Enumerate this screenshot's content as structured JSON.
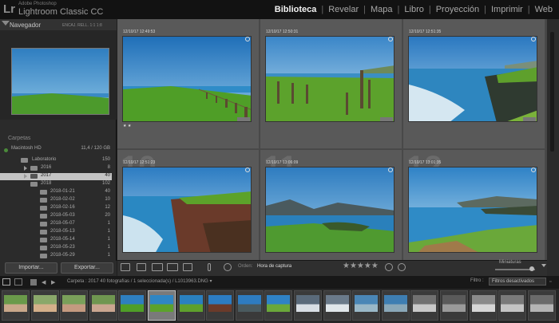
{
  "app": {
    "logo": "Lr",
    "brand_sub": "Adobe Photoshop",
    "brand_main": "Lightroom Classic CC"
  },
  "modules": [
    "Biblioteca",
    "Revelar",
    "Mapa",
    "Libro",
    "Proyección",
    "Imprimir",
    "Web"
  ],
  "active_module": "Biblioteca",
  "navigator": {
    "title": "Navegador",
    "zoom_options": "ENCAJ.  RELL.  1:1  1:8"
  },
  "folders": {
    "header": "Carpetas",
    "drive": {
      "name": "Macintosh HD",
      "info": "11,4 / 120 GB"
    },
    "rows": [
      {
        "label": "Laboratorio",
        "count": "150"
      },
      {
        "label": "2016",
        "count": "8"
      },
      {
        "label": "2017",
        "count": "40"
      },
      {
        "label": "2018",
        "count": "102"
      },
      {
        "label": "2018-01-21",
        "count": "40"
      },
      {
        "label": "2018-02-02",
        "count": "10"
      },
      {
        "label": "2018-02-16",
        "count": "12"
      },
      {
        "label": "2018-05-03",
        "count": "20"
      },
      {
        "label": "2018-05-07",
        "count": "1"
      },
      {
        "label": "2018-05-13",
        "count": "1"
      },
      {
        "label": "2018-05-14",
        "count": "1"
      },
      {
        "label": "2018-05-23",
        "count": "1"
      },
      {
        "label": "2018-05-29",
        "count": "1"
      }
    ]
  },
  "buttons": {
    "import": "Importar...",
    "export": "Exportar..."
  },
  "grid": [
    {
      "num": "",
      "timestamp": "12/10/17 12:49:53",
      "stars": "★ ★"
    },
    {
      "num": "",
      "timestamp": "12/10/17 12:50:31",
      "stars": ""
    },
    {
      "num": "",
      "timestamp": "12/10/17 12:51:35",
      "stars": ""
    },
    {
      "num": "10",
      "timestamp": "12/10/17 12:51:23",
      "stars": ""
    },
    {
      "num": "11",
      "timestamp": "12/10/17 13:06:09",
      "stars": ""
    },
    {
      "num": "12",
      "timestamp": "12/10/17 13:01:35",
      "stars": ""
    }
  ],
  "toolbar": {
    "sort_label": "Orden:",
    "sort_value": "Hora de captura",
    "stars": "★★★★★",
    "thumbs_label": "Miniaturas"
  },
  "filmstrip": {
    "path": "Carpeta : 2017    40 fotografías / 1 seleccionada(s) / L1013963.DNG ▾",
    "filter_label": "Filtro :",
    "filter_value": "Filtros desactivados"
  },
  "colors": {
    "accent_green": "#4a8a3a",
    "selected": "#c4c4c4"
  }
}
